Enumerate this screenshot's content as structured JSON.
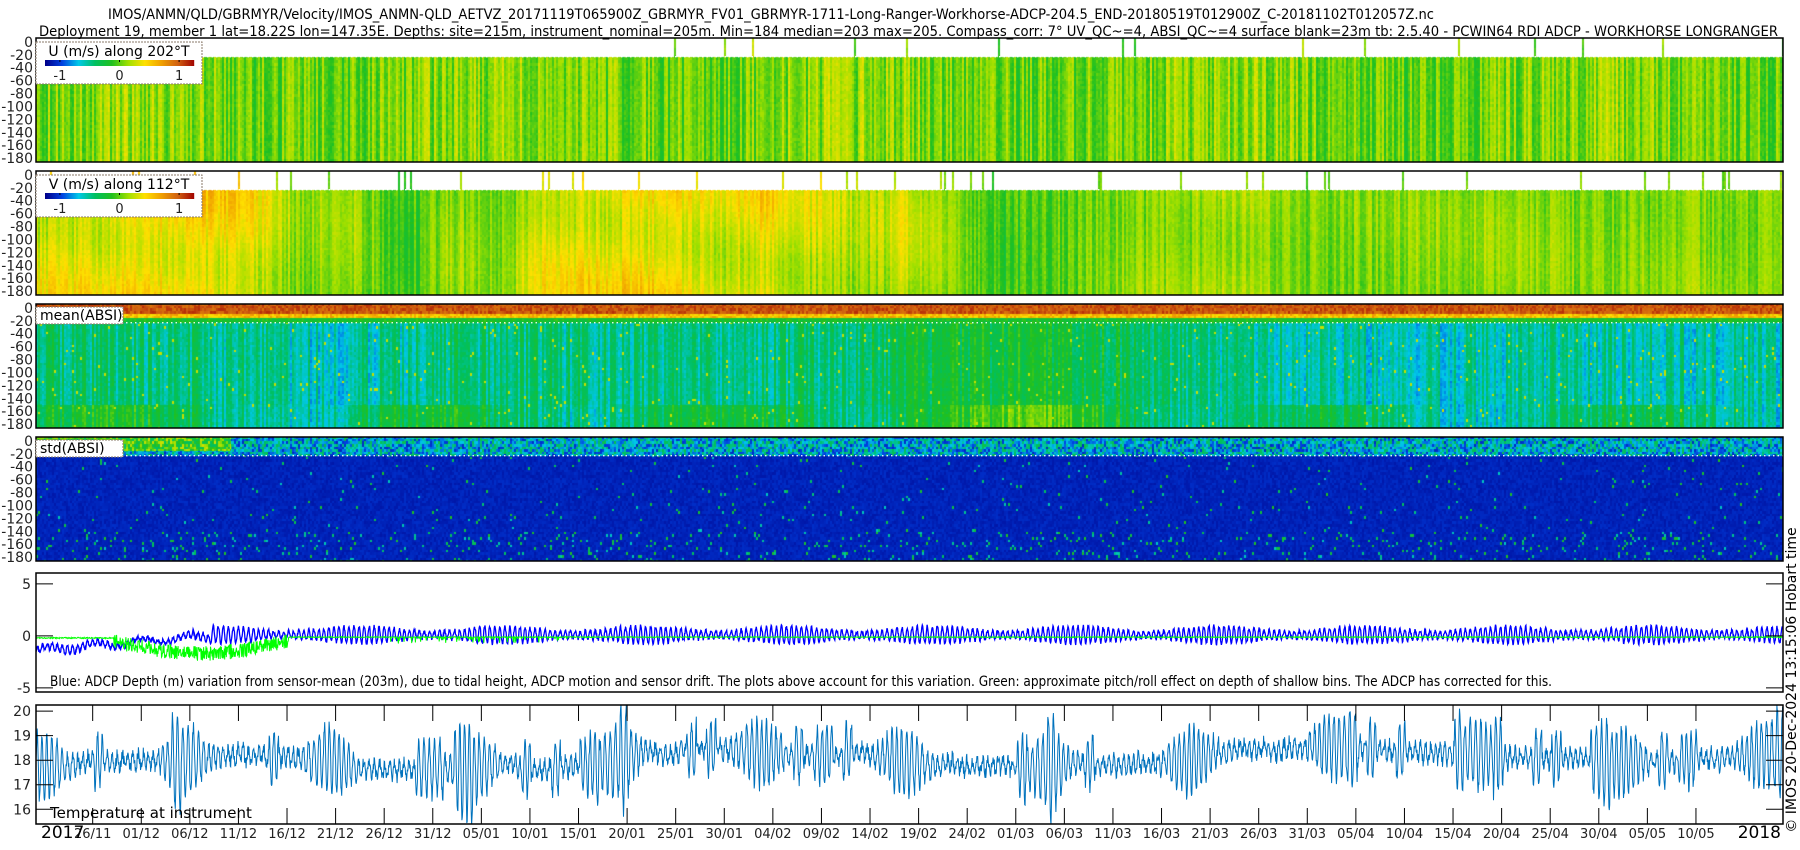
{
  "title": {
    "line1": "IMOS/ANMN/QLD/GBRMYR/Velocity/IMOS_ANMN-QLD_AETVZ_20171119T065900Z_GBRMYR_FV01_GBRMYR-1711-Long-Ranger-Workhorse-ADCP-204.5_END-20180519T012900Z_C-20181102T012057Z.nc",
    "line2": "Deployment 19, member 1 lat=18.22S lon=147.35E. Depths: site=215m, instrument_nominal=205m. Min=184 median=203 max=205. Compass_corr: 7° UV_QC~=4, ABSI_QC~=4 surface blank=23m tb: 2.5.40 - PCWIN64 RDI ADCP - WORKHORSE LONGRANGER"
  },
  "credit": "© IMOS 20-Dec-2024 13:15:06 Hobart time",
  "colors": {
    "colormap": [
      "#00008a",
      "#0040e0",
      "#00c8e8",
      "#00c060",
      "#20c020",
      "#a0e000",
      "#ffe000",
      "#f0a000",
      "#d06010",
      "#a00000"
    ],
    "depth_series": "#0000ff",
    "pitch_roll_series": "#00ff00",
    "temperature_series": "#0072bd"
  },
  "xaxis": {
    "xlim": [
      "2017-11-20T04:00",
      "2018-05-18T23:00"
    ],
    "start_year": "2017",
    "end_year": "2018",
    "ticks": [
      "26/11",
      "01/12",
      "06/12",
      "11/12",
      "16/12",
      "21/12",
      "26/12",
      "31/12",
      "05/01",
      "10/01",
      "15/01",
      "20/01",
      "25/01",
      "30/01",
      "04/02",
      "09/02",
      "14/02",
      "19/02",
      "24/02",
      "01/03",
      "06/03",
      "11/03",
      "16/03",
      "21/03",
      "26/03",
      "31/03",
      "05/04",
      "10/04",
      "15/04",
      "20/04",
      "25/04",
      "30/04",
      "05/05",
      "10/05"
    ]
  },
  "chart_data": [
    {
      "type": "heatmap",
      "variable": "U",
      "legend": "U (m/s) along 202°T",
      "ylim": [
        -186,
        6
      ],
      "yticks": [
        0,
        -20,
        -40,
        -60,
        -80,
        -100,
        -120,
        -140,
        -160,
        -180
      ],
      "clim": [
        -1.25,
        1.25
      ],
      "colorbar_ticks": [
        {
          "value": -1,
          "label": "-1"
        },
        {
          "value": 0,
          "label": "0"
        },
        {
          "value": 1,
          "label": "1"
        }
      ],
      "surface_blank_m": 23
    },
    {
      "type": "heatmap",
      "variable": "V",
      "legend": "V (m/s) along 112°T",
      "ylim": [
        -186,
        6
      ],
      "yticks": [
        0,
        -20,
        -40,
        -60,
        -80,
        -100,
        -120,
        -140,
        -160,
        -180
      ],
      "clim": [
        -1.25,
        1.25
      ],
      "colorbar_ticks": [
        {
          "value": -1,
          "label": "-1"
        },
        {
          "value": 0,
          "label": "0"
        },
        {
          "value": 1,
          "label": "1"
        }
      ],
      "surface_blank_m": 23
    },
    {
      "type": "heatmap",
      "variable": "mean(ABSI)",
      "legend": "mean(ABSI)",
      "ylim": [
        -186,
        6
      ],
      "yticks": [
        0,
        -20,
        -40,
        -60,
        -80,
        -100,
        -120,
        -140,
        -160,
        -180
      ],
      "surface_blank_m": 23
    },
    {
      "type": "heatmap",
      "variable": "std(ABSI)",
      "legend": "std(ABSI)",
      "ylim": [
        -186,
        6
      ],
      "yticks": [
        0,
        -20,
        -40,
        -60,
        -80,
        -100,
        -120,
        -140,
        -160,
        -180
      ],
      "surface_blank_m": 23
    },
    {
      "type": "line",
      "caption": "Blue: ADCP Depth (m) variation from sensor-mean (203m), due to tidal height, ADCP motion and sensor drift. The plots above account for this variation. Green: approximate pitch/roll effect on depth of shallow bins. The ADCP has corrected for this.",
      "ylim": [
        -5.4,
        6.05
      ],
      "yticks": [
        {
          "value": 5,
          "label": "5"
        },
        {
          "value": 0,
          "label": "0"
        },
        {
          "value": -5,
          "label": "-5"
        }
      ],
      "series": [
        {
          "color": "#0000ff"
        },
        {
          "color": "#00ff00"
        }
      ]
    },
    {
      "type": "line",
      "label": "Temperature at instrument",
      "ylim": [
        15.4,
        20.25
      ],
      "yticks": [
        {
          "value": 16,
          "label": "16"
        },
        {
          "value": 17,
          "label": "17"
        },
        {
          "value": 18,
          "label": "18"
        },
        {
          "value": 19,
          "label": "19"
        },
        {
          "value": 20,
          "label": "20"
        }
      ],
      "series": [
        {
          "color": "#0072bd"
        }
      ]
    }
  ]
}
